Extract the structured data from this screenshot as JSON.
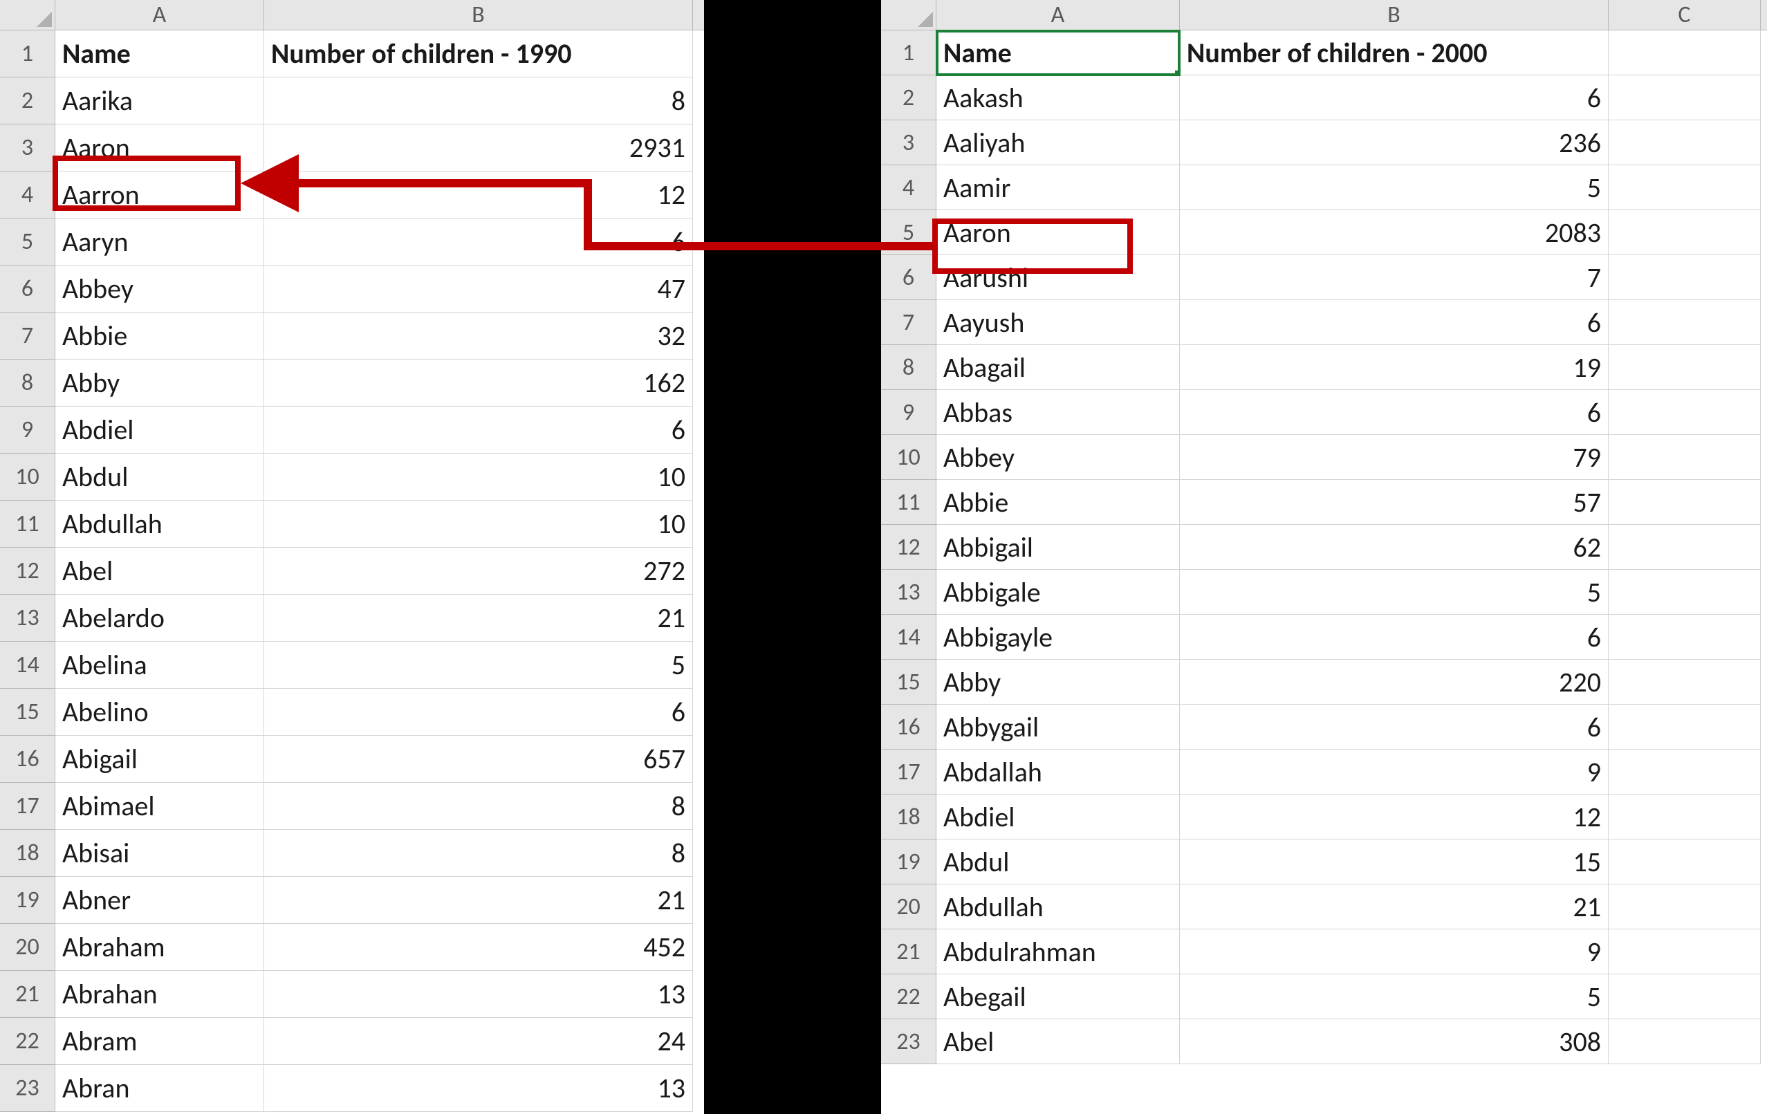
{
  "left": {
    "columns": [
      "A",
      "B"
    ],
    "header": {
      "A": "Name",
      "B": "Number of children - 1990"
    },
    "rows": [
      {
        "n": 2,
        "A": "Aarika",
        "B": "8"
      },
      {
        "n": 3,
        "A": "Aaron",
        "B": "2931"
      },
      {
        "n": 4,
        "A": "Aarron",
        "B": "12"
      },
      {
        "n": 5,
        "A": "Aaryn",
        "B": "6"
      },
      {
        "n": 6,
        "A": "Abbey",
        "B": "47"
      },
      {
        "n": 7,
        "A": "Abbie",
        "B": "32"
      },
      {
        "n": 8,
        "A": "Abby",
        "B": "162"
      },
      {
        "n": 9,
        "A": "Abdiel",
        "B": "6"
      },
      {
        "n": 10,
        "A": "Abdul",
        "B": "10"
      },
      {
        "n": 11,
        "A": "Abdullah",
        "B": "10"
      },
      {
        "n": 12,
        "A": "Abel",
        "B": "272"
      },
      {
        "n": 13,
        "A": "Abelardo",
        "B": "21"
      },
      {
        "n": 14,
        "A": "Abelina",
        "B": "5"
      },
      {
        "n": 15,
        "A": "Abelino",
        "B": "6"
      },
      {
        "n": 16,
        "A": "Abigail",
        "B": "657"
      },
      {
        "n": 17,
        "A": "Abimael",
        "B": "8"
      },
      {
        "n": 18,
        "A": "Abisai",
        "B": "8"
      },
      {
        "n": 19,
        "A": "Abner",
        "B": "21"
      },
      {
        "n": 20,
        "A": "Abraham",
        "B": "452"
      },
      {
        "n": 21,
        "A": "Abrahan",
        "B": "13"
      },
      {
        "n": 22,
        "A": "Abram",
        "B": "24"
      },
      {
        "n": 23,
        "A": "Abran",
        "B": "13"
      }
    ],
    "highlighted_name": "Aaron"
  },
  "right": {
    "columns": [
      "A",
      "B",
      "C"
    ],
    "header": {
      "A": "Name",
      "B": "Number of children - 2000"
    },
    "selected_cell": "A1",
    "rows": [
      {
        "n": 2,
        "A": "Aakash",
        "B": "6"
      },
      {
        "n": 3,
        "A": "Aaliyah",
        "B": "236"
      },
      {
        "n": 4,
        "A": "Aamir",
        "B": "5"
      },
      {
        "n": 5,
        "A": "Aaron",
        "B": "2083"
      },
      {
        "n": 6,
        "A": "Aarushi",
        "B": "7"
      },
      {
        "n": 7,
        "A": "Aayush",
        "B": "6"
      },
      {
        "n": 8,
        "A": "Abagail",
        "B": "19"
      },
      {
        "n": 9,
        "A": "Abbas",
        "B": "6"
      },
      {
        "n": 10,
        "A": "Abbey",
        "B": "79"
      },
      {
        "n": 11,
        "A": "Abbie",
        "B": "57"
      },
      {
        "n": 12,
        "A": "Abbigail",
        "B": "62"
      },
      {
        "n": 13,
        "A": "Abbigale",
        "B": "5"
      },
      {
        "n": 14,
        "A": "Abbigayle",
        "B": "6"
      },
      {
        "n": 15,
        "A": "Abby",
        "B": "220"
      },
      {
        "n": 16,
        "A": "Abbygail",
        "B": "6"
      },
      {
        "n": 17,
        "A": "Abdallah",
        "B": "9"
      },
      {
        "n": 18,
        "A": "Abdiel",
        "B": "12"
      },
      {
        "n": 19,
        "A": "Abdul",
        "B": "15"
      },
      {
        "n": 20,
        "A": "Abdullah",
        "B": "21"
      },
      {
        "n": 21,
        "A": "Abdulrahman",
        "B": "9"
      },
      {
        "n": 22,
        "A": "Abegail",
        "B": "5"
      },
      {
        "n": 23,
        "A": "Abel",
        "B": "308"
      }
    ],
    "highlighted_name": "Aaron"
  },
  "annotation": {
    "color": "#c00000",
    "connects": [
      "left.rows[Aaron]",
      "right.rows[Aaron]"
    ]
  }
}
